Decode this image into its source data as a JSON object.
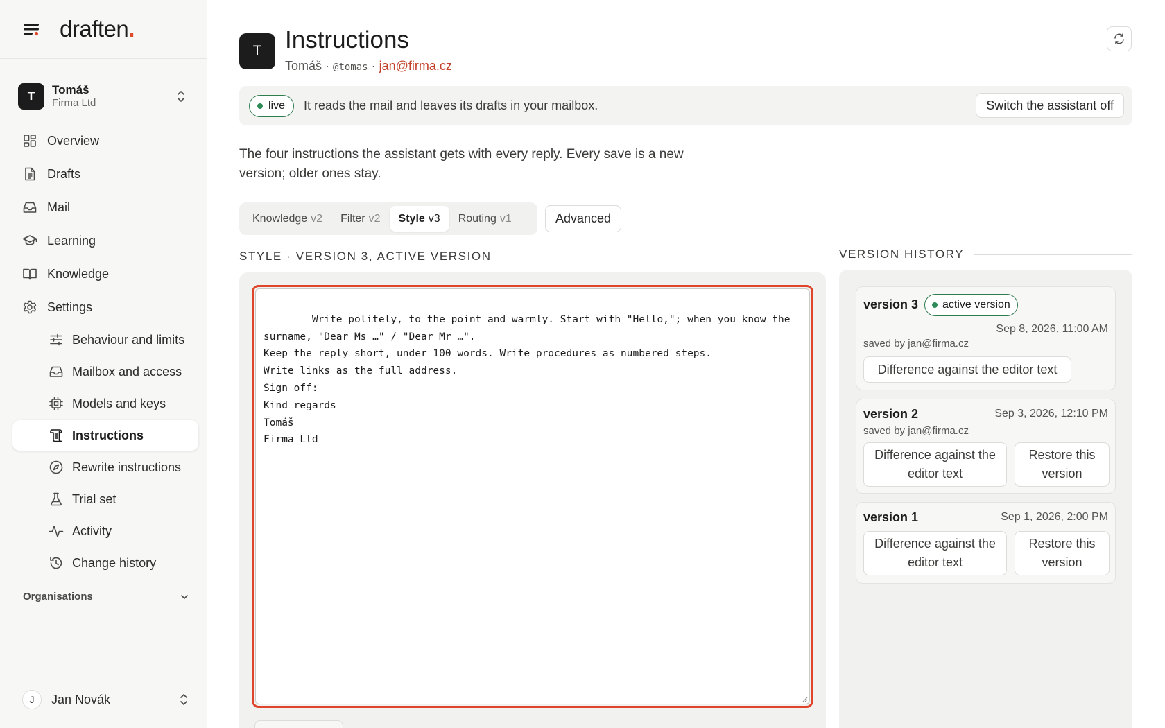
{
  "app": {
    "logo_text": "draften",
    "logo_dot": "."
  },
  "account": {
    "initial": "T",
    "name": "Tomáš",
    "org": "Firma Ltd"
  },
  "nav": {
    "overview": "Overview",
    "drafts": "Drafts",
    "mail": "Mail",
    "learning": "Learning",
    "knowledge": "Knowledge",
    "settings": "Settings",
    "settings_items": {
      "behaviour": "Behaviour and limits",
      "mailbox": "Mailbox and access",
      "models": "Models and keys",
      "instructions": "Instructions",
      "rewrite": "Rewrite instructions",
      "trial": "Trial set",
      "activity": "Activity",
      "change_history": "Change history"
    },
    "active_item": "Instructions"
  },
  "organisations_label": "Organisations",
  "user": {
    "initial": "J",
    "name": "Jan Novák"
  },
  "header": {
    "avatar_initial": "T",
    "title": "Instructions",
    "owner_name": "Tomáš",
    "separator": " · ",
    "handle": "@tomas",
    "email": "jan@firma.cz"
  },
  "status": {
    "badge": "live",
    "text": "It reads the mail and leaves its drafts in your mailbox.",
    "switch_button": "Switch the assistant off"
  },
  "intro": "The four instructions the assistant gets with every reply. Every save is a new version; older ones stay.",
  "tabs": [
    {
      "label": "Knowledge",
      "version": "v2",
      "active": false
    },
    {
      "label": "Filter",
      "version": "v2",
      "active": false
    },
    {
      "label": "Style",
      "version": "v3",
      "active": true
    },
    {
      "label": "Routing",
      "version": "v1",
      "active": false
    }
  ],
  "advanced_button": "Advanced",
  "editor": {
    "heading": "STYLE · VERSION 3, ACTIVE VERSION",
    "text": "Write politely, to the point and warmly. Start with \"Hello,\"; when you know the\nsurname, \"Dear Ms …\" / \"Dear Mr …\".\nKeep the reply short, under 100 words. Write procedures as numbered steps.\nWrite links as the full address.\nSign off:\nKind regards\nTomáš\nFirma Ltd"
  },
  "history": {
    "heading": "VERSION HISTORY",
    "versions": [
      {
        "name": "version 3",
        "badge": "active version",
        "date": "Sep 8, 2026, 11:00 AM",
        "saved_by": "saved by jan@firma.cz",
        "diff_button": "Difference against the editor text"
      },
      {
        "name": "version 2",
        "date": "Sep 3, 2026, 12:10 PM",
        "saved_by": "saved by jan@firma.cz",
        "diff_button": "Difference against the editor text",
        "restore_button": "Restore this version"
      },
      {
        "name": "version 1",
        "date": "Sep 1, 2026, 2:00 PM",
        "diff_button": "Difference against the editor text",
        "restore_button": "Restore this version"
      }
    ]
  },
  "colors": {
    "accent": "#e04a2f",
    "email": "#c2412a",
    "live_green": "#2e8b57",
    "dark": "#1c1c1c"
  },
  "icons": {
    "menu": "menu-icon",
    "overview": "grid-icon",
    "drafts": "document-icon",
    "mail": "inbox-icon",
    "learning": "graduation-cap-icon",
    "knowledge": "book-icon",
    "settings": "gear-icon",
    "behaviour": "sliders-icon",
    "mailbox": "inbox-icon",
    "models": "chip-icon",
    "instructions": "scroll-icon",
    "rewrite": "compass-icon",
    "trial": "flask-icon",
    "activity": "pulse-icon",
    "change_history": "history-icon",
    "refresh": "refresh-icon"
  }
}
